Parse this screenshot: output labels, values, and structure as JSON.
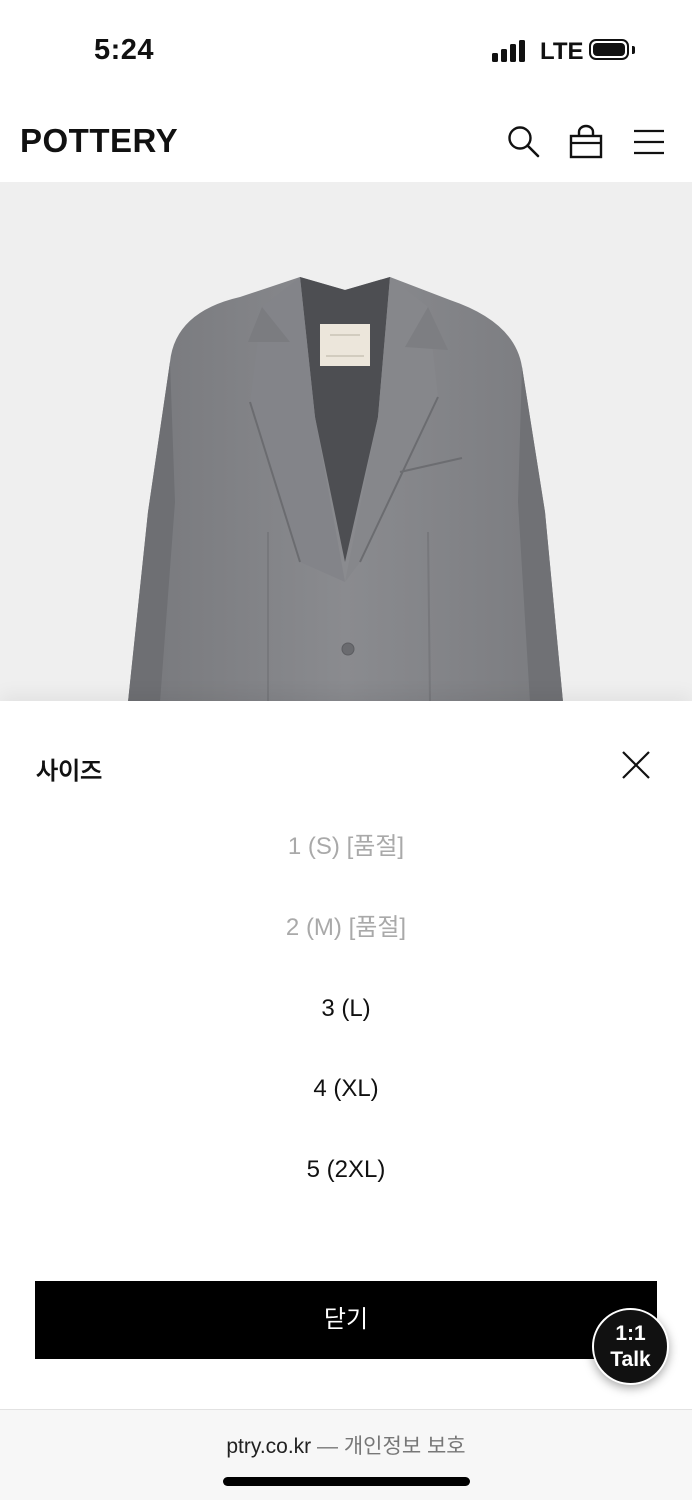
{
  "status_bar": {
    "time": "5:24",
    "network": "LTE",
    "battery_level": 1.0
  },
  "header": {
    "logo": "POTTERY",
    "icons": [
      "search-icon",
      "shopping-bag-icon",
      "menu-icon"
    ]
  },
  "product_image": {
    "subject": "jacket-image"
  },
  "size_sheet": {
    "title": "사이즈",
    "options": [
      {
        "label": "1 (S) [품절]",
        "sold_out": true
      },
      {
        "label": "2 (M) [품절]",
        "sold_out": true
      },
      {
        "label": "3 (L)",
        "sold_out": false
      },
      {
        "label": "4 (XL)",
        "sold_out": false
      },
      {
        "label": "5 (2XL)",
        "sold_out": false
      }
    ],
    "close_label": "닫기"
  },
  "talk_button": {
    "line1": "1:1",
    "line2": "Talk"
  },
  "url_bar": {
    "domain": "ptry.co.kr",
    "separator": "—",
    "privacy": "개인정보 보호"
  },
  "colors": {
    "primary": "#000000",
    "sold_out_text": "#a9a9a9",
    "image_bg": "#efefef"
  }
}
